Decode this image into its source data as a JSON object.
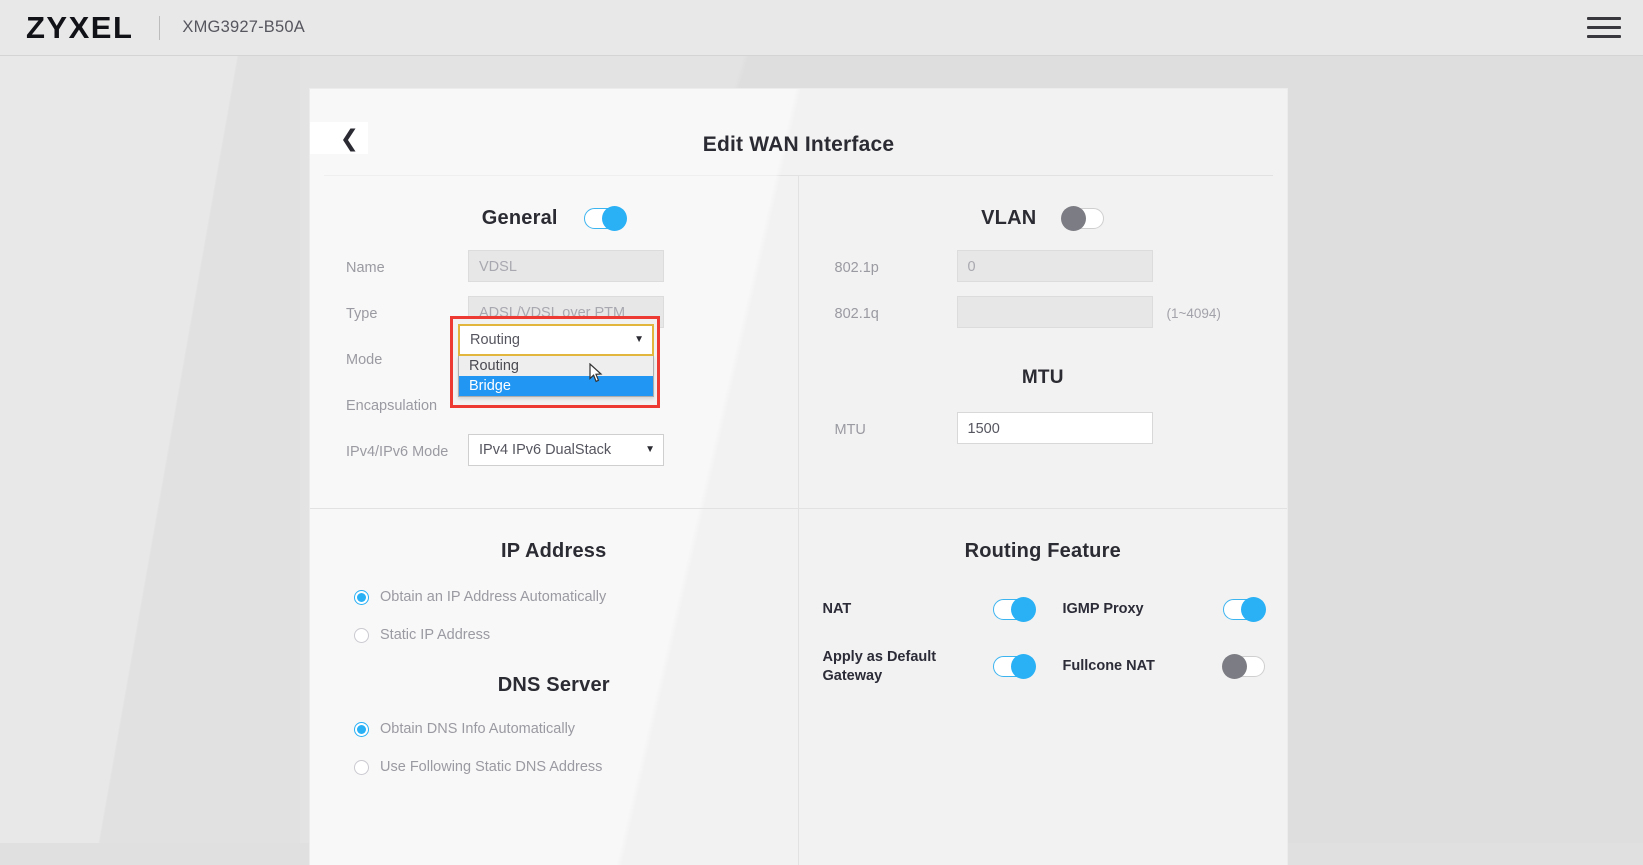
{
  "topbar": {
    "logo": "ZYXEL",
    "model": "XMG3927-B50A",
    "menu_icon": "hamburger-icon"
  },
  "card": {
    "title": "Edit WAN Interface",
    "back_icon": "chevron-left-icon"
  },
  "general": {
    "title": "General",
    "enabled": true,
    "fields": {
      "name_label": "Name",
      "name_value": "VDSL",
      "type_label": "Type",
      "type_value": "ADSL/VDSL over PTM",
      "mode_label": "Mode",
      "mode_value": "Routing",
      "encapsulation_label": "Encapsulation",
      "ip_mode_label": "IPv4/IPv6 Mode",
      "ip_mode_value": "IPv4 IPv6 DualStack"
    },
    "mode_dropdown": {
      "open": true,
      "options": [
        "Routing",
        "Bridge"
      ],
      "highlighted": "Bridge"
    }
  },
  "vlan": {
    "title": "VLAN",
    "enabled": false,
    "fields": {
      "p_label": "802.1p",
      "p_value": "0",
      "q_label": "802.1q",
      "q_value": "",
      "q_hint": "(1~4094)"
    }
  },
  "mtu": {
    "title": "MTU",
    "label": "MTU",
    "value": "1500"
  },
  "ip_address": {
    "title": "IP Address",
    "options": [
      {
        "label": "Obtain an IP Address Automatically",
        "checked": true
      },
      {
        "label": "Static IP Address",
        "checked": false
      }
    ]
  },
  "dns_server": {
    "title": "DNS Server",
    "options": [
      {
        "label": "Obtain DNS Info Automatically",
        "checked": true
      },
      {
        "label": "Use Following Static DNS Address",
        "checked": false
      }
    ]
  },
  "routing_feature": {
    "title": "Routing Feature",
    "items": [
      {
        "label": "NAT",
        "state": true
      },
      {
        "label": "IGMP Proxy",
        "state": true
      },
      {
        "label": "Apply as Default Gateway",
        "state": true
      },
      {
        "label": "Fullcone NAT",
        "state": false
      }
    ]
  },
  "colors": {
    "accent": "#29b0f5",
    "highlight_border": "#ed3b34",
    "option_selected": "#2196f3",
    "focus_border": "#e2b53c",
    "label_muted": "#9a9aa2",
    "label_dark": "#2c2c38"
  }
}
